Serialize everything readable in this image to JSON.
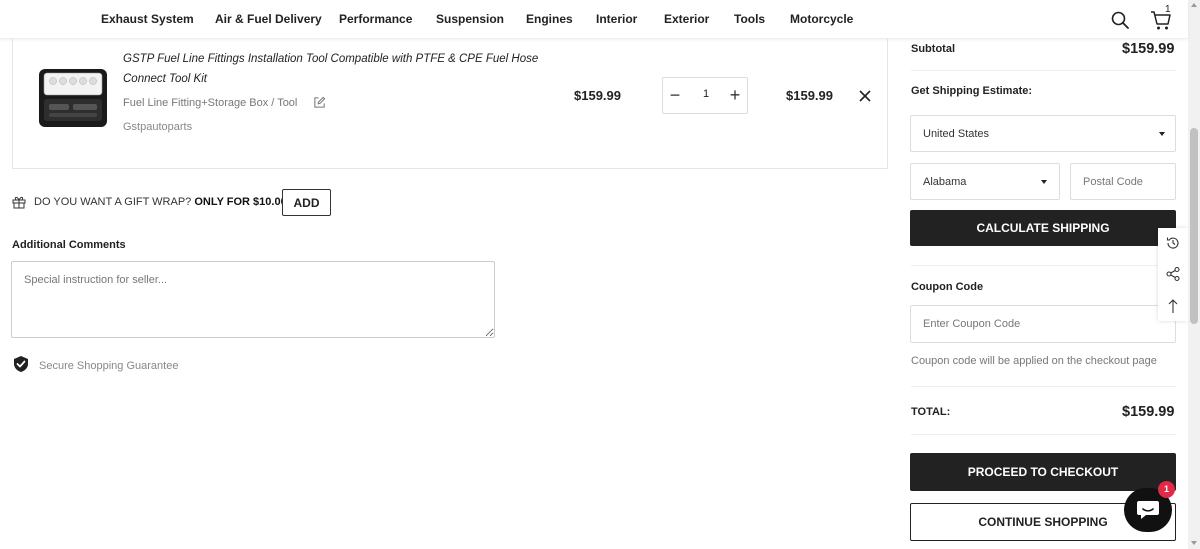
{
  "nav": {
    "items": [
      "Exhaust System",
      "Air & Fuel Delivery",
      "Performance",
      "Suspension",
      "Engines",
      "Interior",
      "Exterior",
      "Tools",
      "Motorcycle"
    ],
    "cart_count": "1"
  },
  "cart": {
    "item": {
      "title": "GSTP Fuel Line Fittings Installation Tool Compatible with PTFE & CPE Fuel Hose Connect Tool Kit",
      "variant": "Fuel Line Fitting+Storage Box / Tool",
      "vendor": "Gstpautoparts",
      "price": "$159.99",
      "quantity": "1",
      "line_total": "$159.99"
    },
    "gift_wrap": {
      "text": "DO YOU WANT A GIFT WRAP?",
      "offer": "ONLY FOR $10.00",
      "button": "ADD"
    },
    "comments": {
      "label": "Additional Comments",
      "placeholder": "Special instruction for seller..."
    },
    "secure_text": "Secure Shopping Guarantee"
  },
  "summary": {
    "subtotal_label": "Subtotal",
    "subtotal_value": "$159.99",
    "shipping_label": "Get Shipping Estimate:",
    "country": "United States",
    "province": "Alabama",
    "postal_placeholder": "Postal Code",
    "calculate_button": "CALCULATE SHIPPING",
    "coupon_label": "Coupon Code",
    "coupon_placeholder": "Enter Coupon Code",
    "coupon_note": "Coupon code will be applied on the checkout page",
    "total_label": "TOTAL:",
    "total_value": "$159.99",
    "checkout_button": "PROCEED TO CHECKOUT",
    "continue_button": "CONTINUE SHOPPING"
  },
  "chat": {
    "badge": "1"
  },
  "colors": {
    "dark": "#222222",
    "badge": "#e02a48"
  }
}
